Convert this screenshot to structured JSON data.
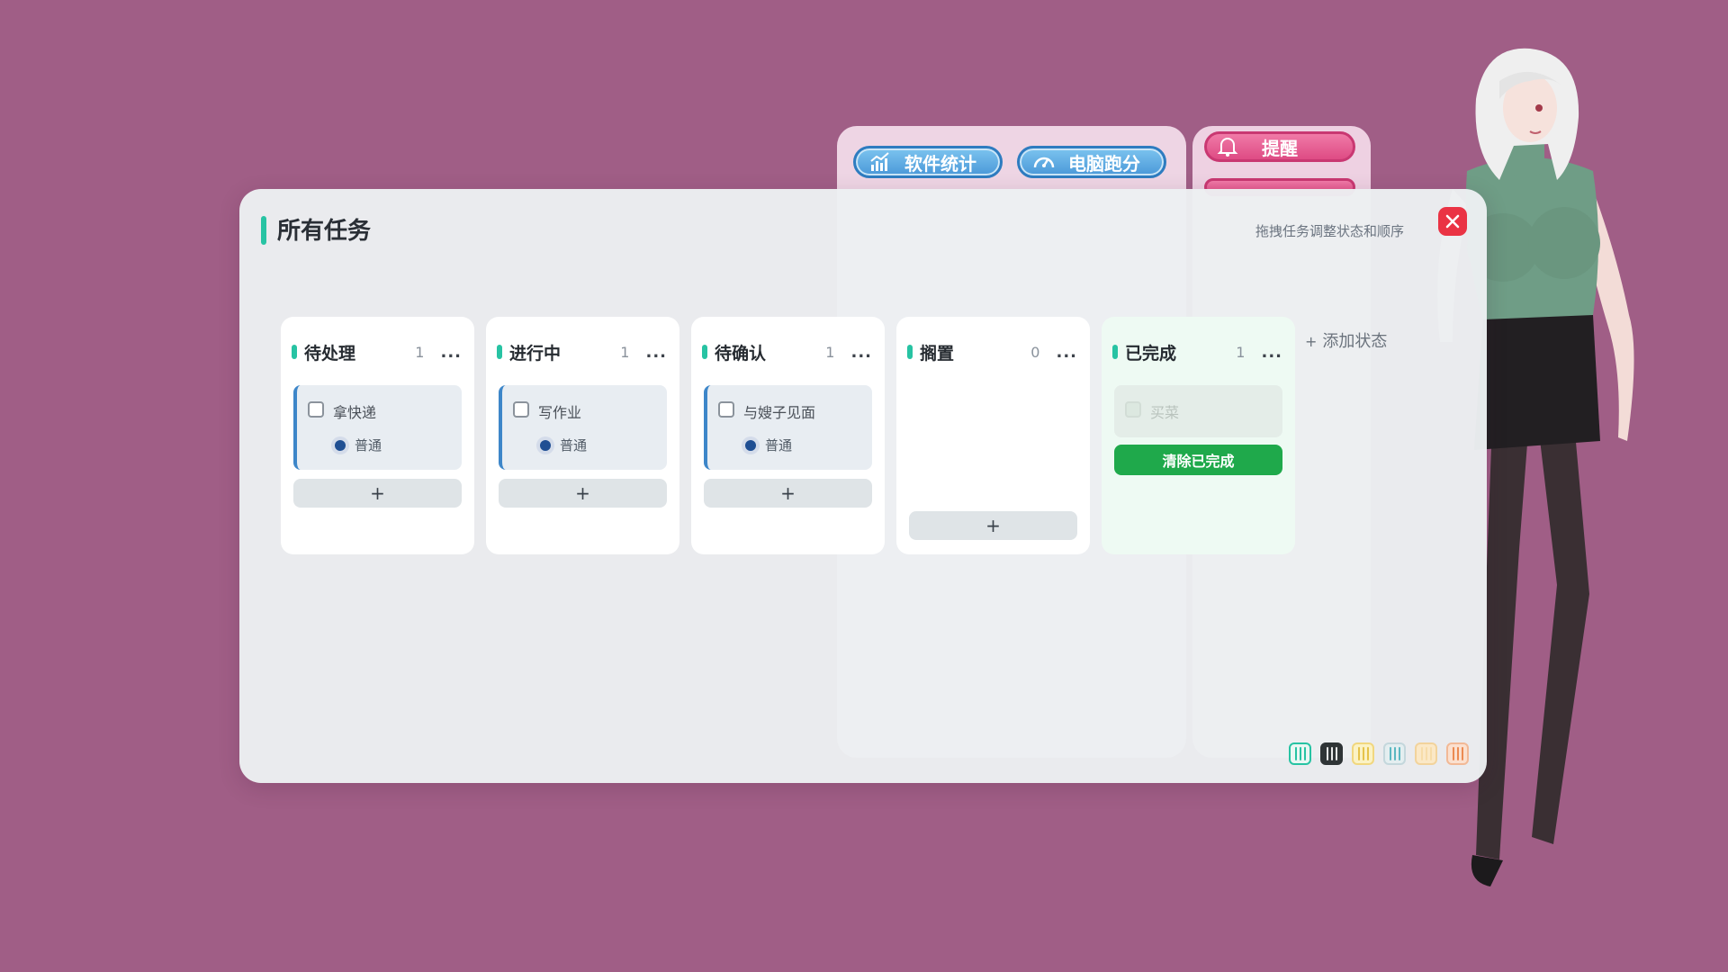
{
  "background": {
    "stats_button": "软件统计",
    "benchmark_button": "电脑跑分",
    "reminder_button": "提醒"
  },
  "dialog": {
    "title": "所有任务",
    "hint": "拖拽任务调整状态和顺序",
    "add_status": "添加状态",
    "add_task_symbol": "+",
    "close_symbol": "×",
    "columns": [
      {
        "name": "待处理",
        "count": "1",
        "more": "...",
        "tasks": [
          {
            "title": "拿快递",
            "priority": "普通"
          }
        ]
      },
      {
        "name": "进行中",
        "count": "1",
        "more": "...",
        "tasks": [
          {
            "title": "写作业",
            "priority": "普通"
          }
        ]
      },
      {
        "name": "待确认",
        "count": "1",
        "more": "...",
        "tasks": [
          {
            "title": "与嫂子见面",
            "priority": "普通"
          }
        ]
      },
      {
        "name": "搁置",
        "count": "0",
        "more": "...",
        "tasks": []
      },
      {
        "name": "已完成",
        "count": "1",
        "more": "...",
        "tasks": [
          {
            "title": "买菜",
            "completed": true
          }
        ],
        "clear_label": "清除已完成"
      }
    ]
  },
  "colors": {
    "accent": "#27c3a3",
    "task_border": "#3d86c9",
    "priority_dot": "#1f4f93",
    "clear_button": "#1fa94b",
    "close_button": "#ea3344",
    "page_background": "#a05e86"
  },
  "themes": [
    {
      "name": "teal-white",
      "bg": "#eaf7f3",
      "border": "#27c3a3",
      "stripe": "#27c3a3"
    },
    {
      "name": "dark",
      "bg": "#2f3436",
      "border": "#2f3436",
      "stripe": "#eaeaea"
    },
    {
      "name": "yellow",
      "bg": "#fbf2c4",
      "border": "#f1d77e",
      "stripe": "#e5c34a"
    },
    {
      "name": "teal-stripe",
      "bg": "#e4eef0",
      "border": "#c4d7dc",
      "stripe": "#5ab7c1"
    },
    {
      "name": "cream",
      "bg": "#fbe8c6",
      "border": "#f2d39c",
      "stripe": "#f7dca9"
    },
    {
      "name": "orange",
      "bg": "#fbe0cf",
      "border": "#f2b996",
      "stripe": "#ec8a52"
    }
  ]
}
